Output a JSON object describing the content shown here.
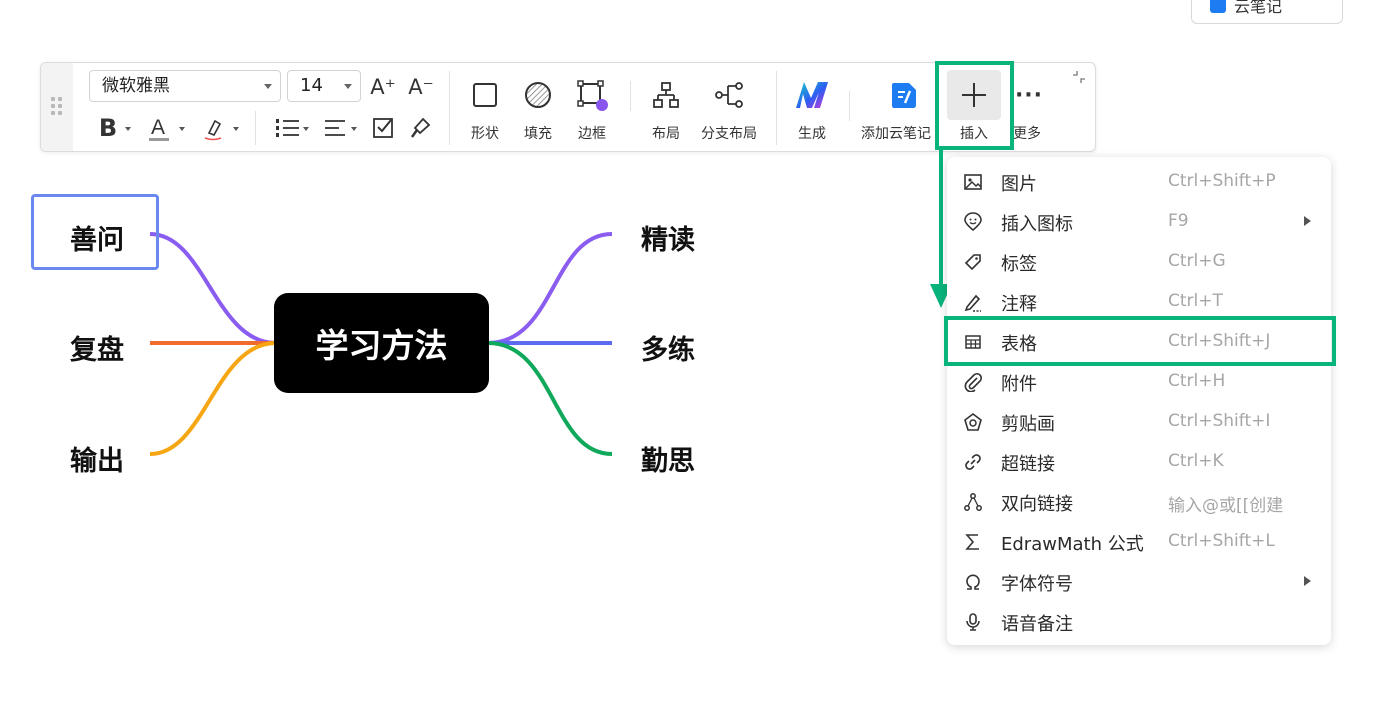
{
  "top_chip": {
    "label": "云笔记"
  },
  "toolbar": {
    "font_family": "微软雅黑",
    "font_size": "14",
    "grow_font": "A⁺",
    "shrink_font": "A⁻",
    "bold": "B",
    "font_color": "A",
    "shape_label": "形状",
    "fill_label": "填充",
    "border_label": "边框",
    "layout_label": "布局",
    "branch_layout_label": "分支布局",
    "generate_label": "生成",
    "cloud_note_label": "添加云笔记",
    "insert_label": "插入",
    "more_label": "更多",
    "colors": {
      "border_dot": "#8855ee",
      "cloud_note": "#1e7cf2",
      "highlight": "#09b37c"
    }
  },
  "insert_menu": {
    "items": [
      {
        "icon": "image-icon",
        "label": "图片",
        "shortcut": "Ctrl+Shift+P",
        "submenu": false
      },
      {
        "icon": "emoji-icon",
        "label": "插入图标",
        "shortcut": "F9",
        "submenu": true
      },
      {
        "icon": "tag-icon",
        "label": "标签",
        "shortcut": "Ctrl+G",
        "submenu": false
      },
      {
        "icon": "note-pen-icon",
        "label": "注释",
        "shortcut": "Ctrl+T",
        "submenu": false
      },
      {
        "icon": "table-icon",
        "label": "表格",
        "shortcut": "Ctrl+Shift+J",
        "submenu": false
      },
      {
        "icon": "paperclip-icon",
        "label": "附件",
        "shortcut": "Ctrl+H",
        "submenu": false
      },
      {
        "icon": "clipart-icon",
        "label": "剪贴画",
        "shortcut": "Ctrl+Shift+I",
        "submenu": false
      },
      {
        "icon": "link-icon",
        "label": "超链接",
        "shortcut": "Ctrl+K",
        "submenu": false
      },
      {
        "icon": "bidirectional-link-icon",
        "label": "双向链接",
        "shortcut": "输入@或[[创建",
        "submenu": false
      },
      {
        "icon": "sigma-icon",
        "label": "EdrawMath 公式",
        "shortcut": "Ctrl+Shift+L",
        "submenu": false
      },
      {
        "icon": "omega-icon",
        "label": "字体符号",
        "shortcut": "",
        "submenu": true
      },
      {
        "icon": "microphone-icon",
        "label": "语音备注",
        "shortcut": "",
        "submenu": false
      }
    ]
  },
  "mindmap": {
    "center": "学习方法",
    "left_branches": [
      {
        "label": "善问",
        "color": "#8a5cf0",
        "selected": true
      },
      {
        "label": "复盘",
        "color": "#f26b2e"
      },
      {
        "label": "输出",
        "color": "#f5a612"
      }
    ],
    "right_branches": [
      {
        "label": "精读",
        "color": "#8a5cf0"
      },
      {
        "label": "多练",
        "color": "#5b6cf0"
      },
      {
        "label": "勤思",
        "color": "#10a85a"
      }
    ]
  }
}
